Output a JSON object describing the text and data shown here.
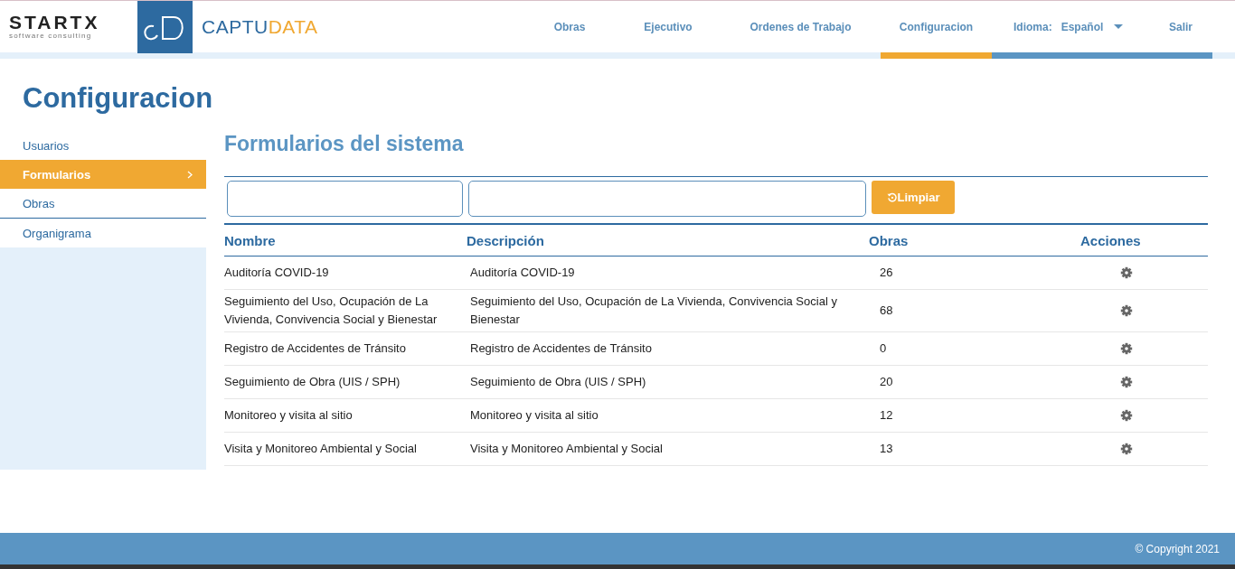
{
  "brand": {
    "company": "STARTX",
    "company_tagline": "software consulting",
    "product_primary": "CAPTU",
    "product_accent": "DATA"
  },
  "nav": [
    {
      "label": "Obras",
      "selected": false
    },
    {
      "label": "Ejecutivo",
      "selected": false
    },
    {
      "label": "Ordenes de Trabajo",
      "selected": false
    },
    {
      "label": "Configuracion",
      "selected": true
    }
  ],
  "language": {
    "label": "Idioma:",
    "value": "Español"
  },
  "logout": "Salir",
  "page_title": "Configuracion",
  "sidebar": {
    "items": [
      {
        "label": "Usuarios",
        "selected": false
      },
      {
        "label": "Formularios",
        "selected": true
      },
      {
        "label": "Obras",
        "selected": false
      },
      {
        "label": "Organigrama",
        "selected": false
      }
    ]
  },
  "section_title": "Formularios del sistema",
  "filters": {
    "clear_button": "Limpiar"
  },
  "table": {
    "columns": [
      "Nombre",
      "Descripción",
      "Obras",
      "Acciones"
    ],
    "rows": [
      {
        "nombre": "Auditoría COVID-19",
        "descripcion": "Auditoría COVID-19",
        "obras": "26"
      },
      {
        "nombre": "Seguimiento del Uso, Ocupación de La Vivienda, Convivencia Social y Bienestar",
        "descripcion": "Seguimiento del Uso, Ocupación de La Vivienda, Convivencia Social y Bienestar",
        "obras": "68"
      },
      {
        "nombre": "Registro de Accidentes de Tránsito",
        "descripcion": "Registro de Accidentes de Tránsito",
        "obras": "0"
      },
      {
        "nombre": "Seguimiento de Obra (UIS / SPH)",
        "descripcion": "Seguimiento de Obra (UIS / SPH)",
        "obras": "20"
      },
      {
        "nombre": "Monitoreo y visita al sitio",
        "descripcion": "Monitoreo y visita al sitio",
        "obras": "12"
      },
      {
        "nombre": "Visita y Monitoreo Ambiental y Social",
        "descripcion": "Visita y Monitoreo Ambiental y Social",
        "obras": "13"
      }
    ]
  },
  "footer": "© Copyright 2021"
}
